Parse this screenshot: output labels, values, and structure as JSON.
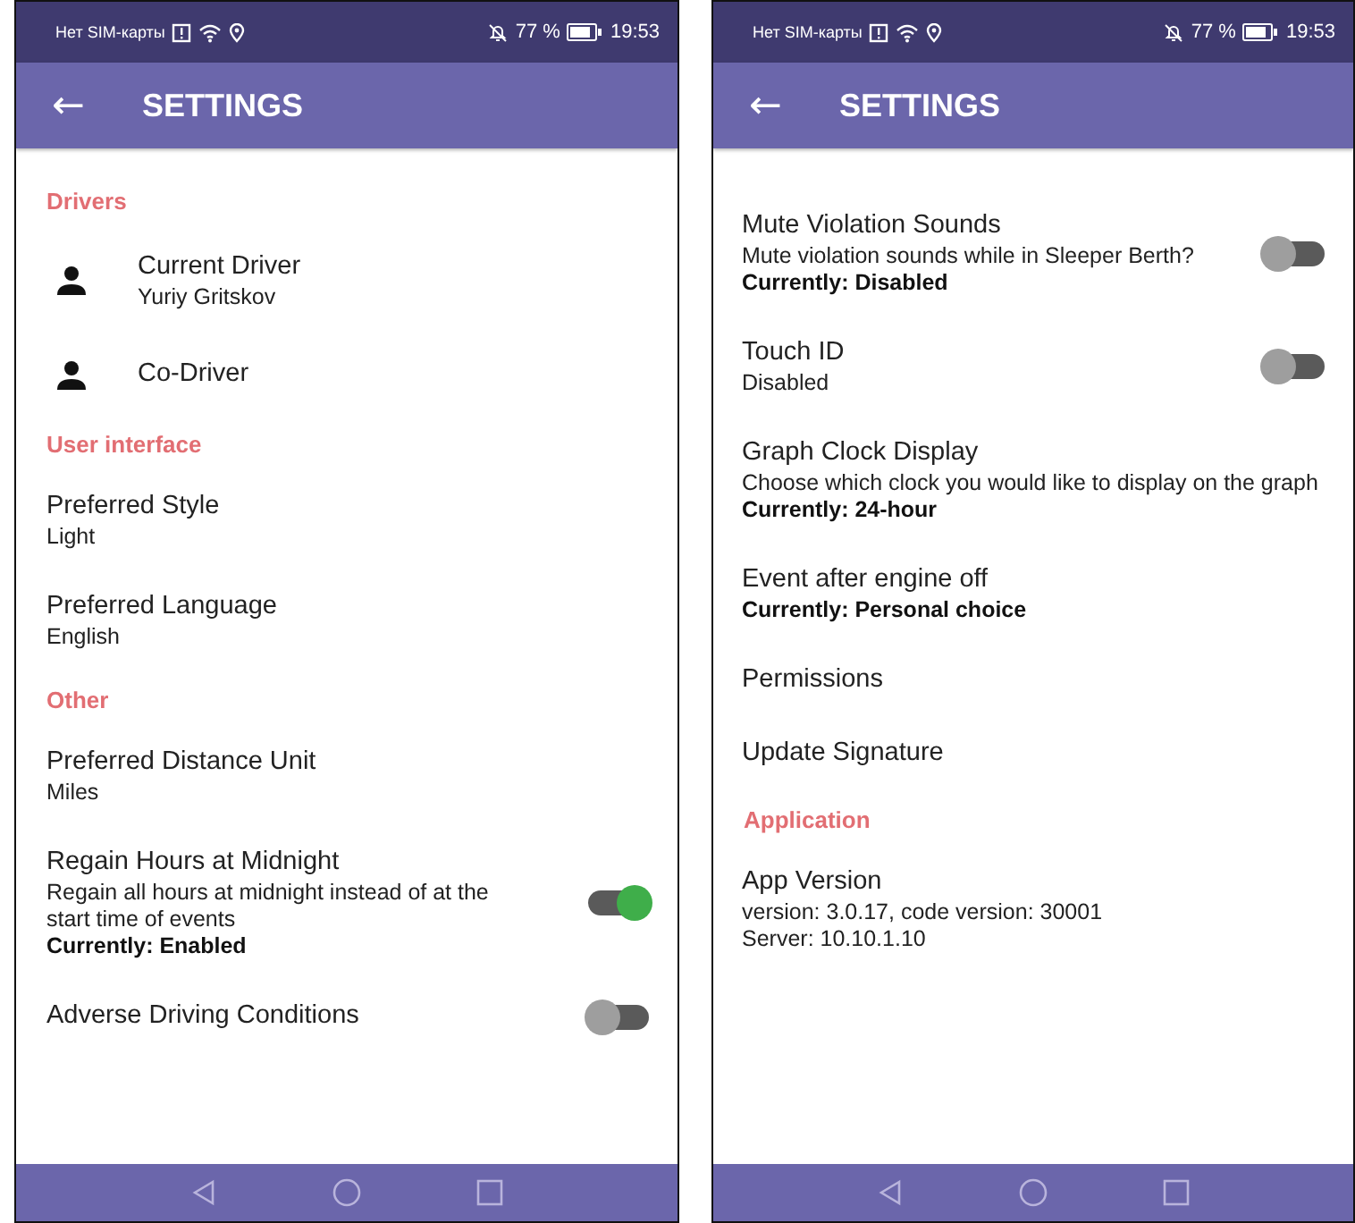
{
  "phones": [
    {
      "status_bar": {
        "carrier": "Нет SIM-карты",
        "battery": "77 %",
        "time": "19:53"
      },
      "title": "SETTINGS",
      "back": "←",
      "items": [
        {
          "kind": "section",
          "title": "Drivers"
        },
        {
          "kind": "driver",
          "title": "Current Driver",
          "subtitle": "Yuriy Gritskov"
        },
        {
          "kind": "driver",
          "title": "Co-Driver"
        },
        {
          "kind": "section",
          "title": "User interface"
        },
        {
          "kind": "setting",
          "title": "Preferred Style",
          "subtitle": "Light"
        },
        {
          "kind": "setting",
          "title": "Preferred Language",
          "subtitle": "English"
        },
        {
          "kind": "section",
          "title": "Other"
        },
        {
          "kind": "setting",
          "title": "Preferred Distance Unit",
          "subtitle": "Miles"
        },
        {
          "kind": "toggle",
          "title": "Regain Hours at Midnight",
          "subtitle": "Regain all hours at midnight instead of at the start time of events",
          "status": "Currently: Enabled",
          "on": true
        },
        {
          "kind": "toggle",
          "title": "Adverse Driving Conditions",
          "on": false
        }
      ]
    },
    {
      "status_bar": {
        "carrier": "Нет SIM-карты",
        "battery": "77 %",
        "time": "19:53"
      },
      "title": "SETTINGS",
      "back": "←",
      "items": [
        {
          "kind": "toggle",
          "title": "Mute Violation Sounds",
          "subtitle": "Mute violation sounds while in Sleeper Berth?",
          "status": "Currently: Disabled",
          "on": false
        },
        {
          "kind": "toggle",
          "title": "Touch ID",
          "subtitle": "Disabled",
          "on": false
        },
        {
          "kind": "setting",
          "title": "Graph Clock Display",
          "subtitle": "Choose which clock you would like to display on the graph",
          "status": "Currently: 24-hour"
        },
        {
          "kind": "setting",
          "title": "Event after engine off",
          "status": "Currently: Personal choice"
        },
        {
          "kind": "setting",
          "title": "Permissions"
        },
        {
          "kind": "setting",
          "title": "Update Signature"
        },
        {
          "kind": "section",
          "title": "Application"
        },
        {
          "kind": "setting",
          "title": "App Version",
          "subtitle": "version: 3.0.17, code version: 30001\nServer: 10.10.1.10"
        }
      ]
    }
  ]
}
